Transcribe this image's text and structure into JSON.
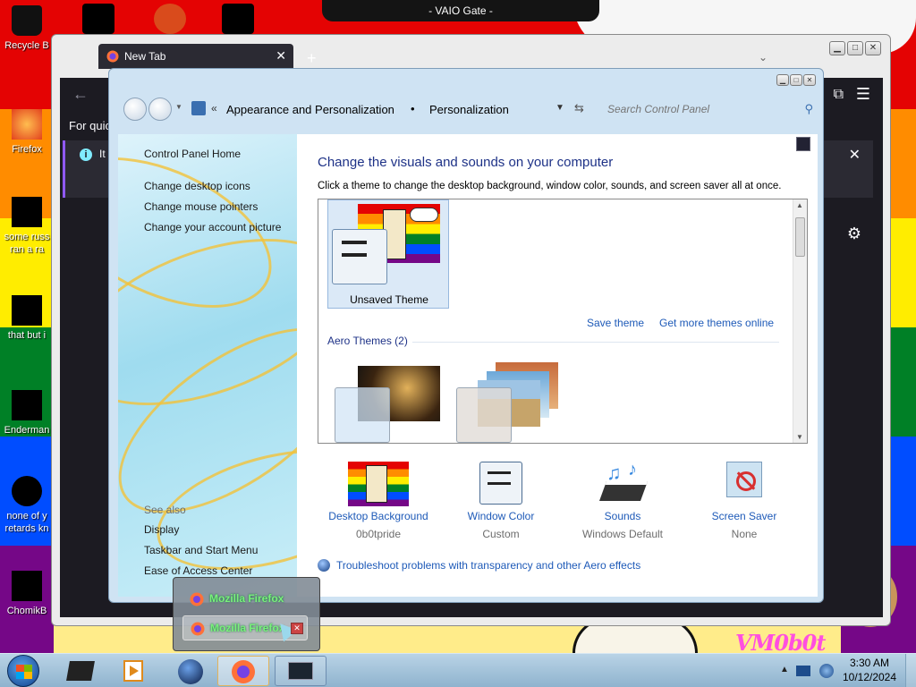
{
  "desktop": {
    "banner": "- VAIO Gate -",
    "watermark": "VM0b0t",
    "icons": [
      {
        "label": "Recycle B"
      },
      {
        "label": "Firefox"
      },
      {
        "label": "some russ"
      },
      {
        "label": "ran a ra"
      },
      {
        "label": "that but i"
      },
      {
        "label": "Enderman"
      },
      {
        "label": "none of y"
      },
      {
        "label": "retards kn"
      },
      {
        "label": "ChomikB"
      }
    ]
  },
  "firefox": {
    "tab_label": "New Tab",
    "tab_close": "✕",
    "new_tab": "+",
    "quick_text": "For quic",
    "info_text": "It",
    "info_close": "✕"
  },
  "control_panel": {
    "breadcrumb": {
      "chevrons": "«",
      "item1": "Appearance and Personalization",
      "sep": "•",
      "item2": "Personalization"
    },
    "search_placeholder": "Search Control Panel",
    "left_links": {
      "home": "Control Panel Home",
      "desktop_icons": "Change desktop icons",
      "mouse_pointers": "Change mouse pointers",
      "account_picture": "Change your account picture"
    },
    "see_also": {
      "header": "See also",
      "display": "Display",
      "taskbar": "Taskbar and Start Menu",
      "ease": "Ease of Access Center"
    },
    "heading": "Change the visuals and sounds on your computer",
    "subheading": "Click a theme to change the desktop background, window color, sounds, and screen saver all at once.",
    "unsaved_theme": "Unsaved Theme",
    "save_theme": "Save theme",
    "get_more_themes": "Get more themes online",
    "aero_header": "Aero Themes (2)",
    "bottom": [
      {
        "name": "Desktop Background",
        "value": "0b0tpride"
      },
      {
        "name": "Window Color",
        "value": "Custom"
      },
      {
        "name": "Sounds",
        "value": "Windows Default"
      },
      {
        "name": "Screen Saver",
        "value": "None"
      }
    ],
    "troubleshoot": "Troubleshoot problems with transparency and other Aero effects"
  },
  "taskbar_popup": {
    "item1": "Mozilla Firefox",
    "item2": "Mozilla Firefox"
  },
  "clock": {
    "time": "3:30 AM",
    "date": "10/12/2024"
  },
  "colors": {
    "link": "#1e5ab8",
    "heading": "#1e3287"
  }
}
